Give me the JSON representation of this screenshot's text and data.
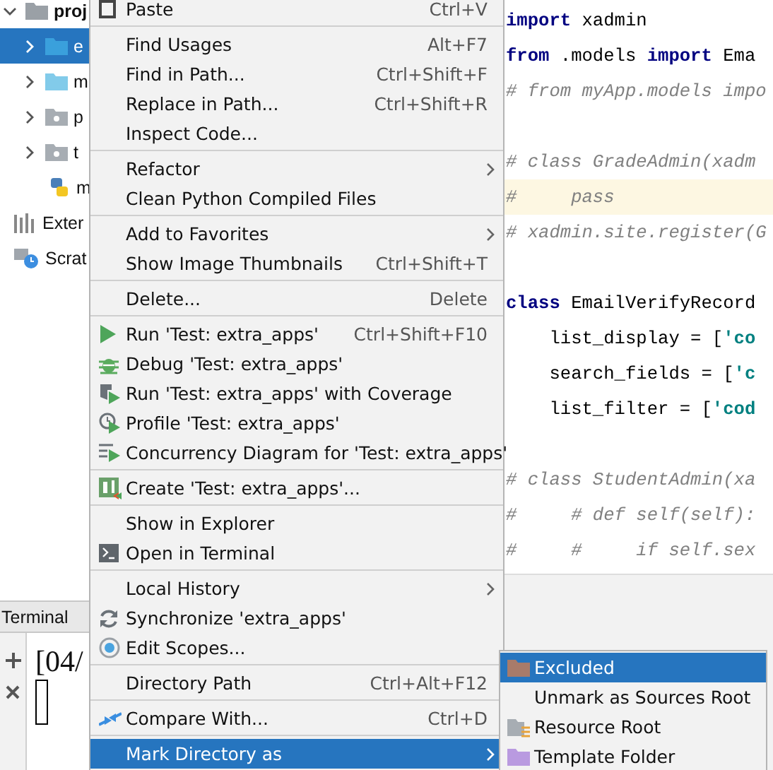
{
  "project_tree": [
    {
      "label": "proj",
      "kind": "root",
      "selected": false
    },
    {
      "label": "e",
      "kind": "folder",
      "selected": true
    },
    {
      "label": "m",
      "kind": "source",
      "selected": false
    },
    {
      "label": "p",
      "kind": "package",
      "selected": false
    },
    {
      "label": "t",
      "kind": "package",
      "selected": false
    },
    {
      "label": "m",
      "kind": "python",
      "selected": false
    },
    {
      "label": "Exter",
      "kind": "libraries",
      "selected": false
    },
    {
      "label": "Scrat",
      "kind": "scratches",
      "selected": false
    }
  ],
  "terminal": {
    "tab": "Terminal",
    "output": "[04/"
  },
  "editor": {
    "lines": [
      {
        "highlighted": false,
        "tokens": [
          {
            "text": "import",
            "kind": "keyword"
          },
          {
            "text": " xadmin",
            "kind": "plain"
          }
        ]
      },
      {
        "highlighted": false,
        "tokens": [
          {
            "text": "from",
            "kind": "keyword"
          },
          {
            "text": " .models ",
            "kind": "plain"
          },
          {
            "text": "import",
            "kind": "keyword"
          },
          {
            "text": " Ema",
            "kind": "plain"
          }
        ]
      },
      {
        "highlighted": false,
        "tokens": [
          {
            "text": "# from myApp.models impo",
            "kind": "comment"
          }
        ]
      },
      {
        "highlighted": false
      },
      {
        "highlighted": false,
        "tokens": [
          {
            "text": "# class GradeAdmin(xadm",
            "kind": "comment"
          }
        ]
      },
      {
        "highlighted": true,
        "tokens": [
          {
            "text": "#     pass",
            "kind": "comment"
          }
        ]
      },
      {
        "highlighted": false,
        "tokens": [
          {
            "text": "# xadmin.site.register(G",
            "kind": "comment"
          }
        ]
      },
      {
        "highlighted": false
      },
      {
        "highlighted": false,
        "tokens": [
          {
            "text": "class",
            "kind": "keyword"
          },
          {
            "text": " EmailVerifyRecord",
            "kind": "plain"
          }
        ]
      },
      {
        "highlighted": false,
        "tokens": [
          {
            "text": "    list_display = [",
            "kind": "plain"
          },
          {
            "text": "'co",
            "kind": "string"
          }
        ]
      },
      {
        "highlighted": false,
        "tokens": [
          {
            "text": "    search_fields = [",
            "kind": "plain"
          },
          {
            "text": "'c",
            "kind": "string"
          }
        ]
      },
      {
        "highlighted": false,
        "tokens": [
          {
            "text": "    list_filter = [",
            "kind": "plain"
          },
          {
            "text": "'cod",
            "kind": "string"
          }
        ]
      },
      {
        "highlighted": false
      },
      {
        "highlighted": false,
        "tokens": [
          {
            "text": "# class StudentAdmin(xa",
            "kind": "comment"
          }
        ]
      },
      {
        "highlighted": false,
        "tokens": [
          {
            "text": "#     # def self(self):",
            "kind": "comment"
          }
        ]
      },
      {
        "highlighted": false,
        "tokens": [
          {
            "text": "#     #     if self.sex",
            "kind": "comment"
          }
        ]
      }
    ]
  },
  "context_menu": {
    "items": [
      {
        "kind": "paste",
        "label": "Paste",
        "shortcut": "Ctrl+V",
        "submenu": false,
        "selected": false
      },
      {
        "kind": "separator"
      },
      {
        "kind": "plain",
        "label": "Find Usages",
        "shortcut": "Alt+F7",
        "submenu": false,
        "selected": false
      },
      {
        "kind": "plain",
        "label": "Find in Path...",
        "shortcut": "Ctrl+Shift+F",
        "submenu": false,
        "selected": false
      },
      {
        "kind": "plain",
        "label": "Replace in Path...",
        "shortcut": "Ctrl+Shift+R",
        "submenu": false,
        "selected": false
      },
      {
        "kind": "plain",
        "label": "Inspect Code...",
        "submenu": false,
        "selected": false
      },
      {
        "kind": "separator"
      },
      {
        "kind": "plain",
        "label": "Refactor",
        "submenu": true,
        "selected": false
      },
      {
        "kind": "plain",
        "label": "Clean Python Compiled Files",
        "submenu": false,
        "selected": false
      },
      {
        "kind": "separator"
      },
      {
        "kind": "plain",
        "label": "Add to Favorites",
        "submenu": true,
        "selected": false
      },
      {
        "kind": "plain",
        "label": "Show Image Thumbnails",
        "shortcut": "Ctrl+Shift+T",
        "submenu": false,
        "selected": false
      },
      {
        "kind": "separator"
      },
      {
        "kind": "plain",
        "label": "Delete...",
        "shortcut": "Delete",
        "submenu": false,
        "selected": false
      },
      {
        "kind": "separator"
      },
      {
        "kind": "run",
        "label": "Run 'Test: extra_apps'",
        "shortcut": "Ctrl+Shift+F10",
        "submenu": false,
        "selected": false
      },
      {
        "kind": "debug",
        "label": "Debug 'Test: extra_apps'",
        "submenu": false,
        "selected": false
      },
      {
        "kind": "coverage",
        "label": "Run 'Test: extra_apps' with Coverage",
        "submenu": false,
        "selected": false
      },
      {
        "kind": "profile",
        "label": "Profile 'Test: extra_apps'",
        "submenu": false,
        "selected": false
      },
      {
        "kind": "concurrency",
        "label": "Concurrency Diagram for 'Test: extra_apps'",
        "submenu": false,
        "selected": false
      },
      {
        "kind": "separator"
      },
      {
        "kind": "create",
        "label": "Create 'Test: extra_apps'...",
        "submenu": false,
        "selected": false
      },
      {
        "kind": "separator"
      },
      {
        "kind": "plain",
        "label": "Show in Explorer",
        "submenu": false,
        "selected": false
      },
      {
        "kind": "terminal",
        "label": "Open in Terminal",
        "submenu": false,
        "selected": false
      },
      {
        "kind": "separator"
      },
      {
        "kind": "plain",
        "label": "Local History",
        "submenu": true,
        "selected": false
      },
      {
        "kind": "sync",
        "label": "Synchronize 'extra_apps'",
        "submenu": false,
        "selected": false
      },
      {
        "kind": "scopes",
        "label": "Edit Scopes...",
        "submenu": false,
        "selected": false
      },
      {
        "kind": "separator"
      },
      {
        "kind": "plain",
        "label": "Directory Path",
        "shortcut": "Ctrl+Alt+F12",
        "submenu": false,
        "selected": false
      },
      {
        "kind": "separator"
      },
      {
        "kind": "compare",
        "label": "Compare With...",
        "shortcut": "Ctrl+D",
        "submenu": false,
        "selected": false
      },
      {
        "kind": "separator"
      },
      {
        "kind": "plain",
        "label": "Mark Directory as",
        "submenu": true,
        "selected": true
      }
    ]
  },
  "submenu": {
    "items": [
      {
        "kind": "excluded",
        "label": "Excluded",
        "selected": true
      },
      {
        "kind": "plain",
        "label": "Unmark as Sources Root",
        "selected": false
      },
      {
        "kind": "resource",
        "label": "Resource Root",
        "selected": false
      },
      {
        "kind": "template",
        "label": "Template Folder",
        "selected": false
      }
    ]
  }
}
